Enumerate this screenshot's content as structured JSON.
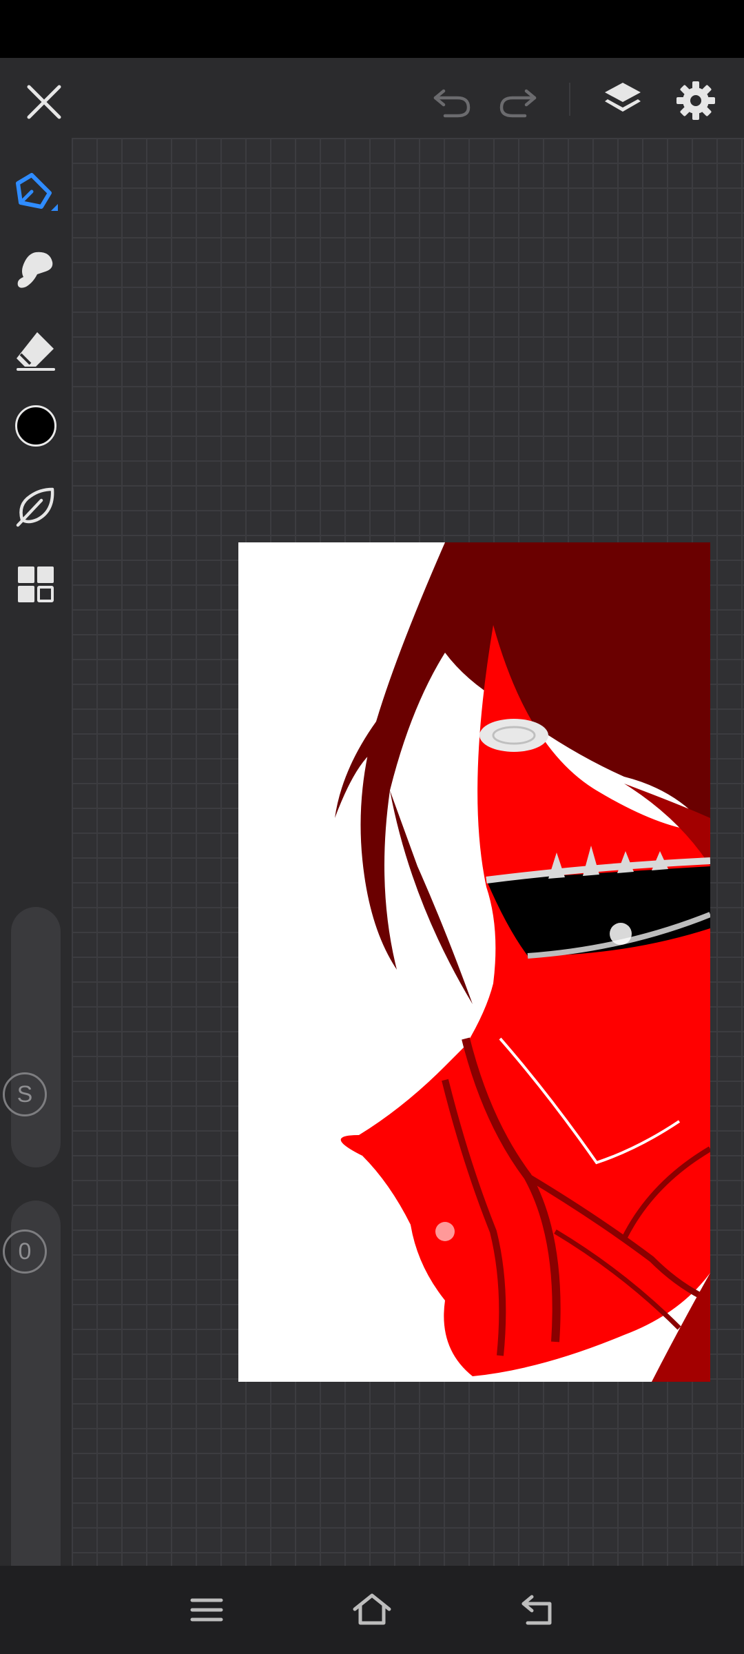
{
  "app": {
    "top_bar": {
      "close": "close-icon",
      "undo": "undo-icon",
      "redo": "redo-icon",
      "layers": "layers-icon",
      "settings": "gear-icon"
    },
    "tools": [
      {
        "name": "pen",
        "icon": "pen-icon",
        "active": true,
        "color": "#2f8cff"
      },
      {
        "name": "smudge",
        "icon": "smudge-icon",
        "active": false
      },
      {
        "name": "eraser",
        "icon": "eraser-icon",
        "active": false
      },
      {
        "name": "color",
        "icon": "color-swatch",
        "value": "#000000"
      },
      {
        "name": "stabilizer",
        "icon": "leaf-icon",
        "active": false
      },
      {
        "name": "gallery",
        "icon": "grid-icon",
        "active": false
      }
    ],
    "brush_size": {
      "label": "S",
      "icon": "size-icon"
    },
    "opacity": {
      "label": "0",
      "icon": "opacity-icon"
    },
    "canvas": {
      "background": "#ffffff",
      "colors": {
        "dark_red": "#6a0000",
        "red": "#ff0000",
        "mid_red": "#a30000"
      }
    },
    "navigation": [
      "menu-icon",
      "home-icon",
      "back-icon"
    ]
  }
}
